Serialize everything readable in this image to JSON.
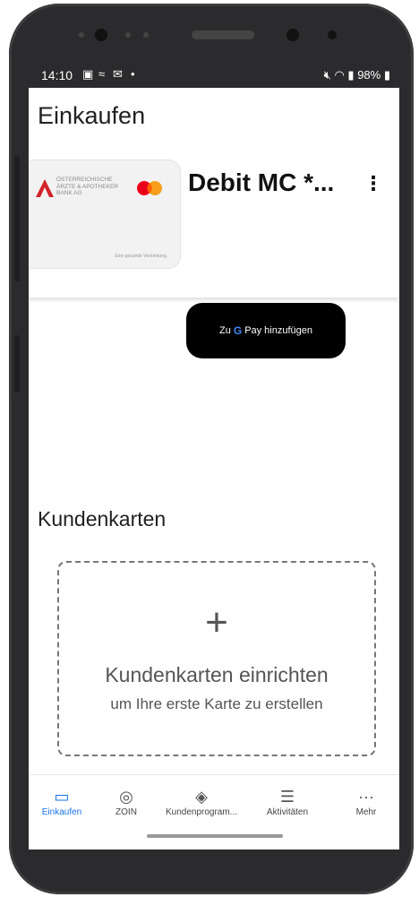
{
  "status_bar": {
    "time": "14:10",
    "left_icons": [
      "image-icon",
      "signal-wave-icon",
      "mail-icon",
      "dot-icon"
    ],
    "right_text": "98%",
    "right_icons": [
      "mute-icon",
      "wifi-icon",
      "signal-icon",
      "battery-icon"
    ]
  },
  "page": {
    "title": "Einkaufen"
  },
  "card": {
    "bank_name": "ÖSTERREICHISCHE ÄRZTE & APOTHEKER BANK AG",
    "footer": "Eine gesunde Verbindung.",
    "name": "Debit MC *...",
    "menu_icon": "more-vert-icon",
    "gpay_prefix": "Zu",
    "gpay_brand_g": "G",
    "gpay_brand_pay": "Pay",
    "gpay_suffix": "hinzufügen"
  },
  "loyalty": {
    "title": "Kundenkarten",
    "add_icon": "plus-icon",
    "add_title": "Kundenkarten einrichten",
    "add_subtitle": "um Ihre erste Karte zu erstellen"
  },
  "nav": {
    "items": [
      {
        "label": "Einkaufen",
        "icon": "card-icon",
        "active": true
      },
      {
        "label": "ZOIN",
        "icon": "zoin-icon",
        "active": false
      },
      {
        "label": "Kundenprogram...",
        "icon": "ticket-icon",
        "active": false
      },
      {
        "label": "Aktivitäten",
        "icon": "list-icon",
        "active": false
      },
      {
        "label": "Mehr",
        "icon": "more-horiz-icon",
        "active": false
      }
    ]
  }
}
